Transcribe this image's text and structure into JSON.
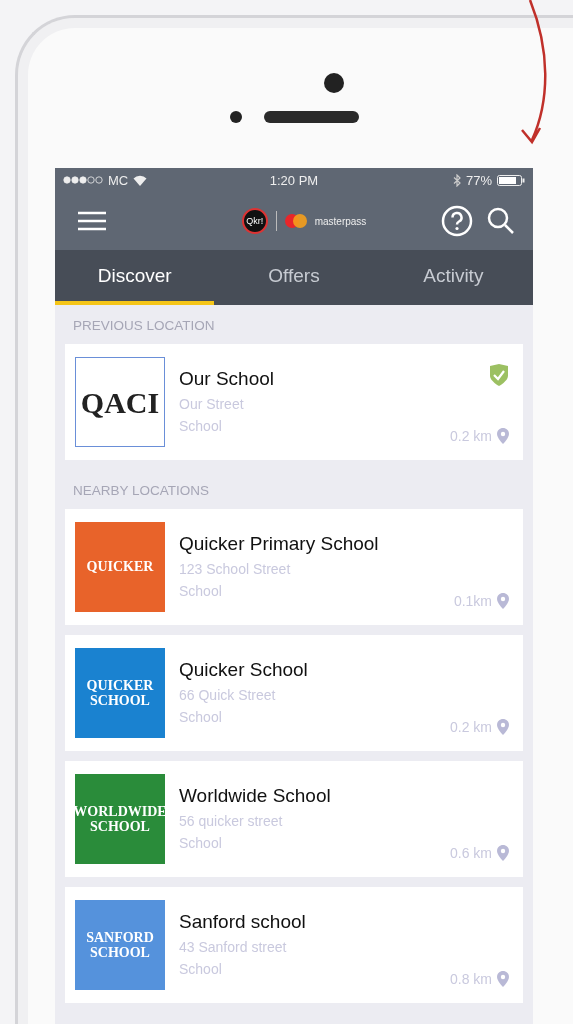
{
  "status_bar": {
    "carrier": "MC",
    "time": "1:20 PM",
    "battery": "77%"
  },
  "header": {
    "app_logo": "Qkr!",
    "partner_logo": "masterpass"
  },
  "tabs": [
    {
      "label": "Discover",
      "selected": true
    },
    {
      "label": "Offers",
      "selected": false
    },
    {
      "label": "Activity",
      "selected": false
    }
  ],
  "sections": [
    {
      "title": "PREVIOUS LOCATION",
      "locations": [
        {
          "name": "Our School",
          "address": "Our Street",
          "category": "School",
          "distance": "0.2 km",
          "verified": true,
          "logo_text": "QACI",
          "color": "#ffffff"
        }
      ]
    },
    {
      "title": "NEARBY LOCATIONS",
      "locations": [
        {
          "name": "Quicker Primary School",
          "address": "123 School Street",
          "category": "School",
          "distance": "0.1km",
          "verified": false,
          "logo_text": "QUICKER",
          "color": "#e8632a"
        },
        {
          "name": "Quicker School",
          "address": "66 Quick Street",
          "category": "School",
          "distance": "0.2 km",
          "verified": false,
          "logo_text": "QUICKER SCHOOL",
          "color": "#1a82d0"
        },
        {
          "name": "Worldwide School",
          "address": "56 quicker street",
          "category": "School",
          "distance": "0.6 km",
          "verified": false,
          "logo_text": "WORLDWIDE SCHOOL",
          "color": "#2a8c3a"
        },
        {
          "name": "Sanford school",
          "address": "43 Sanford street",
          "category": "School",
          "distance": "0.8 km",
          "verified": false,
          "logo_text": "SANFORD SCHOOL",
          "color": "#5592dc"
        }
      ]
    }
  ]
}
